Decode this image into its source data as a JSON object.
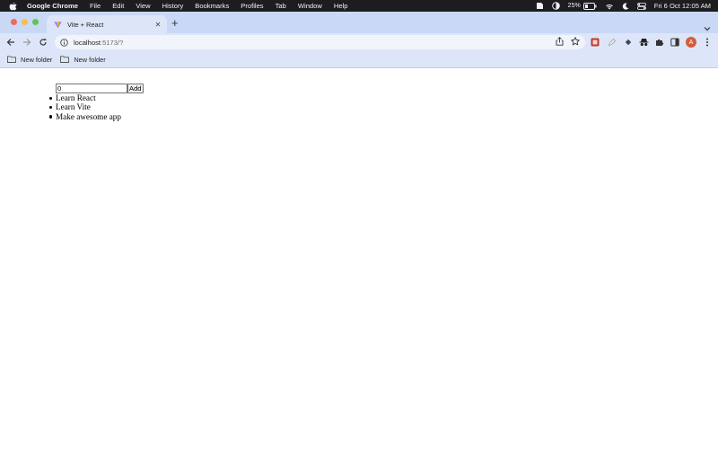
{
  "menubar": {
    "app_name": "Google Chrome",
    "items": [
      "File",
      "Edit",
      "View",
      "History",
      "Bookmarks",
      "Profiles",
      "Tab",
      "Window",
      "Help"
    ],
    "battery": "25%",
    "datetime": "Fri 6 Oct  12:05 AM"
  },
  "browser": {
    "tab_title": "Vite + React",
    "url_host": "localhost",
    "url_path": ":5173/?",
    "avatar_initial": "A",
    "bookmarks": [
      "New folder",
      "New folder"
    ]
  },
  "app": {
    "input_value": "0",
    "add_label": "Add",
    "todos": [
      "Learn React",
      "Learn Vite",
      "Make awesome app"
    ]
  }
}
